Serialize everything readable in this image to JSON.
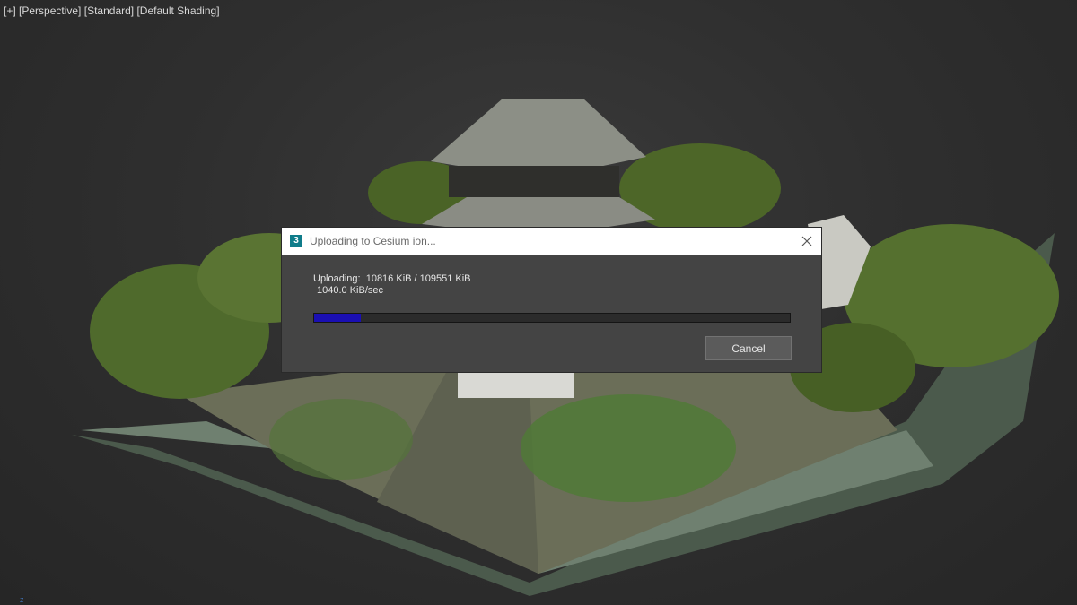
{
  "viewport": {
    "label_plus": "[+]",
    "label_view": "[Perspective]",
    "label_material": "[Standard]",
    "label_shading": "[Default Shading]",
    "axis": "z"
  },
  "dialog": {
    "title": "Uploading to Cesium ion...",
    "icon_text": "3",
    "upload_status": "Uploading:  10816 KiB / 109551 KiB",
    "speed": "1040.0 KiB/sec",
    "progress_fraction": 0.0987,
    "cancel_label": "Cancel"
  },
  "colors": {
    "progress_fill": "#1a0fb3",
    "dialog_bg": "#444444",
    "app_icon": "#0f7c8a"
  }
}
